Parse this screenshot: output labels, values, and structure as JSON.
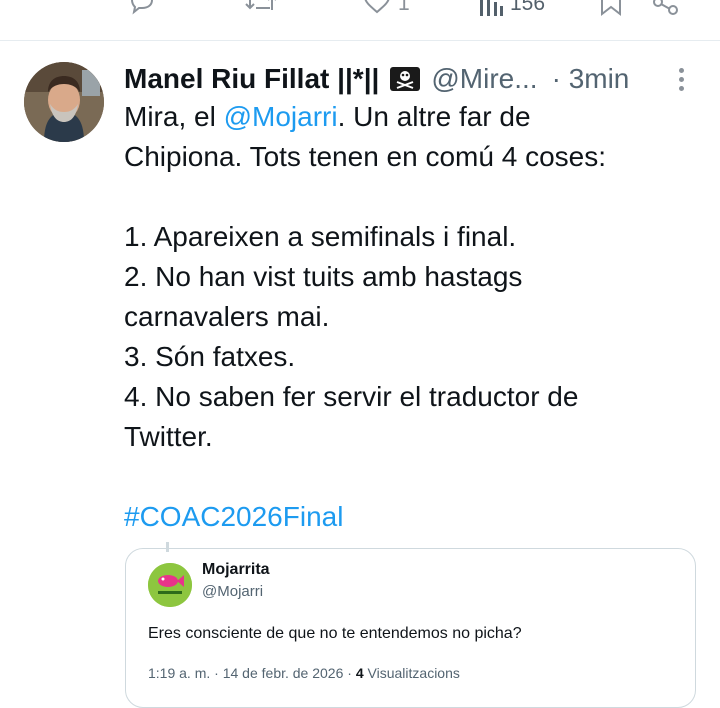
{
  "actions": {
    "reply_count": "",
    "retweet_count": "",
    "like_count": "1",
    "views_count": "156"
  },
  "tweet": {
    "author_name": "Manel Riu Fillat ||*||",
    "author_handle": "@Mire...",
    "separator": "·",
    "time": "3min",
    "body": {
      "line1_pre": "Mira, el ",
      "mention": "@Mojarri",
      "line1_post": ". Un altre far de",
      "line2": "Chipiona. Tots tenen en comú 4 coses:",
      "item1": "1. Apareixen a semifinals i final.",
      "item2a": "2. No han vist tuits amb hastags",
      "item2b": "carnavalers mai.",
      "item3": "3. Són fatxes.",
      "item4a": "4. No saben fer servir el traductor de",
      "item4b": "Twitter.",
      "hashtag": "#COAC2026Final"
    },
    "icons": {
      "pirate_flag": "pirate-flag-emoji",
      "more": "more-vertical-icon"
    }
  },
  "quote": {
    "name": "Mojarrita",
    "handle": "@Mojarri",
    "text": "Eres consciente de que no te entendemos no picha?",
    "time": "1:19 a. m.",
    "sep": "·",
    "date": "14 de febr. de 2026",
    "sep2": "·",
    "views_count": "4",
    "views_label": "Visualitzacions"
  },
  "colors": {
    "link": "#1d9bf0",
    "secondary_text": "#536471",
    "quote_avatar_bg": "#8dc63f",
    "border": "#cfd9de"
  }
}
